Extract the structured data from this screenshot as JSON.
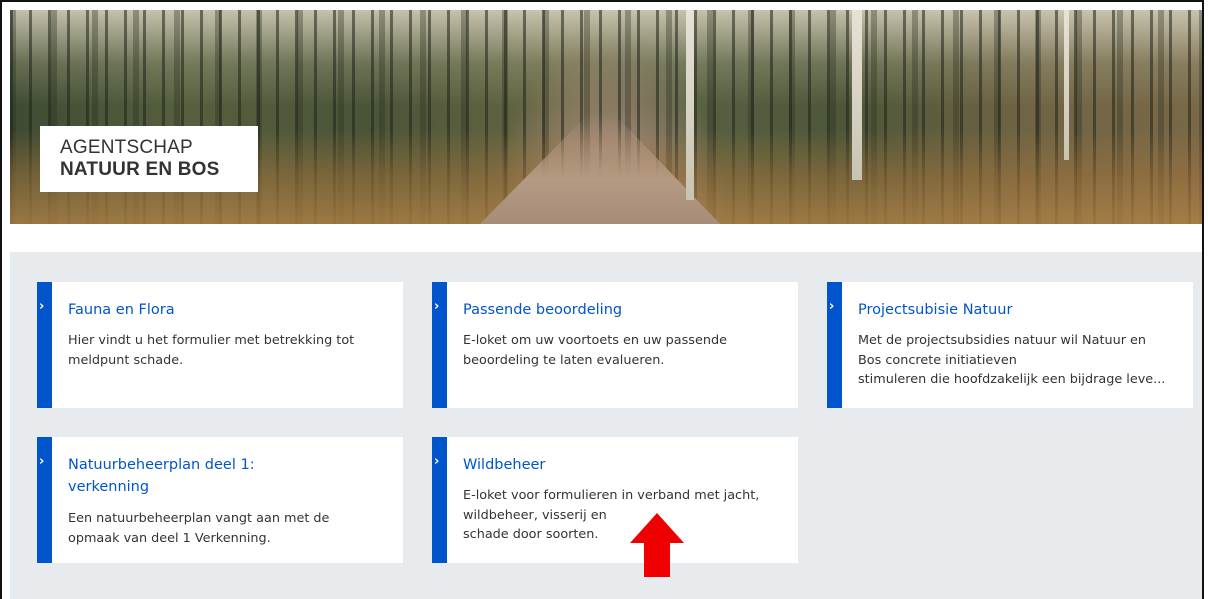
{
  "header": {
    "logo_line1": "AGENTSCHAP",
    "logo_line2": "NATUUR EN BOS"
  },
  "cards": [
    {
      "title": "Fauna en Flora",
      "description": "Hier vindt u het formulier met betrekking tot\nmeldpunt schade."
    },
    {
      "title": "Passende beoordeling",
      "description": "E-loket om uw voortoets en uw passende\nbeoordeling te laten evalueren."
    },
    {
      "title": "Projectsubisie Natuur",
      "description": "Met de projectsubsidies natuur wil Natuur en\nBos concrete initiatieven\nstimuleren die hoofdzakelijk een bijdrage leve..."
    },
    {
      "title": "Natuurbeheerplan deel 1:\nverkenning",
      "description": "Een natuurbeheerplan vangt aan met de\nopmaak van deel 1 Verkenning."
    },
    {
      "title": "Wildbeheer",
      "description": "E-loket voor formulieren in verband met jacht,\nwildbeheer, visserij en\nschade door soorten."
    }
  ],
  "icons": {
    "card_chevron": "chevron-right-icon",
    "annotation": "red-arrow-up-icon"
  },
  "colors": {
    "accent_blue": "#0055cc",
    "panel_bg": "#e8ebee",
    "annotation_red": "#ee0000"
  }
}
